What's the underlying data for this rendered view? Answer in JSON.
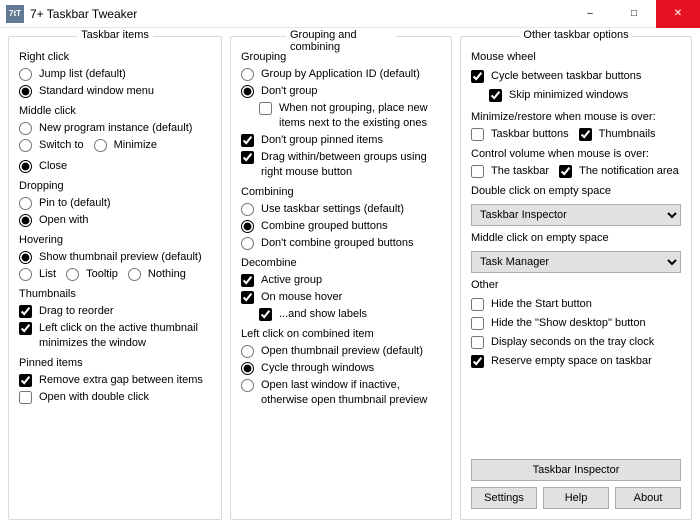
{
  "window": {
    "icon_text": "7tT",
    "title": "7+ Taskbar Tweaker"
  },
  "col1": {
    "title": "Taskbar items",
    "right_click": {
      "heading": "Right click",
      "jump_list": "Jump list (default)",
      "standard_menu": "Standard window menu"
    },
    "middle_click": {
      "heading": "Middle click",
      "new_program": "New program instance (default)",
      "switch_to": "Switch to",
      "minimize": "Minimize",
      "close": "Close"
    },
    "dropping": {
      "heading": "Dropping",
      "pin_to": "Pin to (default)",
      "open_with": "Open with"
    },
    "hovering": {
      "heading": "Hovering",
      "show_thumb": "Show thumbnail preview (default)",
      "list": "List",
      "tooltip": "Tooltip",
      "nothing": "Nothing"
    },
    "thumbnails": {
      "heading": "Thumbnails",
      "drag_reorder": "Drag to reorder",
      "left_click_active": "Left click on the active thumbnail minimizes the window"
    },
    "pinned": {
      "heading": "Pinned items",
      "remove_gap": "Remove extra gap between items",
      "open_dbl": "Open with double click"
    }
  },
  "col2": {
    "title": "Grouping and combining",
    "grouping": {
      "heading": "Grouping",
      "by_appid": "Group by Application ID (default)",
      "dont_group": "Don't group",
      "place_new": "When not grouping, place new items next to the existing ones",
      "dont_group_pinned": "Don't group pinned items",
      "drag_within": "Drag within/between groups using right mouse button"
    },
    "combining": {
      "heading": "Combining",
      "use_settings": "Use taskbar settings (default)",
      "combine_grouped": "Combine grouped buttons",
      "dont_combine": "Don't combine grouped buttons"
    },
    "decombine": {
      "heading": "Decombine",
      "active_group": "Active group",
      "on_hover": "On mouse hover",
      "show_labels": "...and show labels"
    },
    "left_click_combined": {
      "heading": "Left click on combined item",
      "open_thumb": "Open thumbnail preview (default)",
      "cycle": "Cycle through windows",
      "open_last": "Open last window if inactive, otherwise open thumbnail preview"
    }
  },
  "col3": {
    "title": "Other taskbar options",
    "mouse_wheel": {
      "heading": "Mouse wheel",
      "cycle_buttons": "Cycle between taskbar buttons",
      "skip_minimized": "Skip minimized windows"
    },
    "min_restore": {
      "heading": "Minimize/restore when mouse is over:",
      "taskbar_buttons": "Taskbar buttons",
      "thumbnails": "Thumbnails"
    },
    "control_volume": {
      "heading": "Control volume when mouse is over:",
      "the_taskbar": "The taskbar",
      "notif_area": "The notification area"
    },
    "dbl_click": {
      "heading": "Double click on empty space",
      "value": "Taskbar Inspector"
    },
    "mid_click": {
      "heading": "Middle click on empty space",
      "value": "Task Manager"
    },
    "other": {
      "heading": "Other",
      "hide_start": "Hide the Start button",
      "hide_show_desktop": "Hide the \"Show desktop\" button",
      "display_seconds": "Display seconds on the tray clock",
      "reserve_empty": "Reserve empty space on taskbar"
    },
    "inspector_btn": "Taskbar Inspector",
    "buttons": {
      "settings": "Settings",
      "help": "Help",
      "about": "About"
    }
  }
}
